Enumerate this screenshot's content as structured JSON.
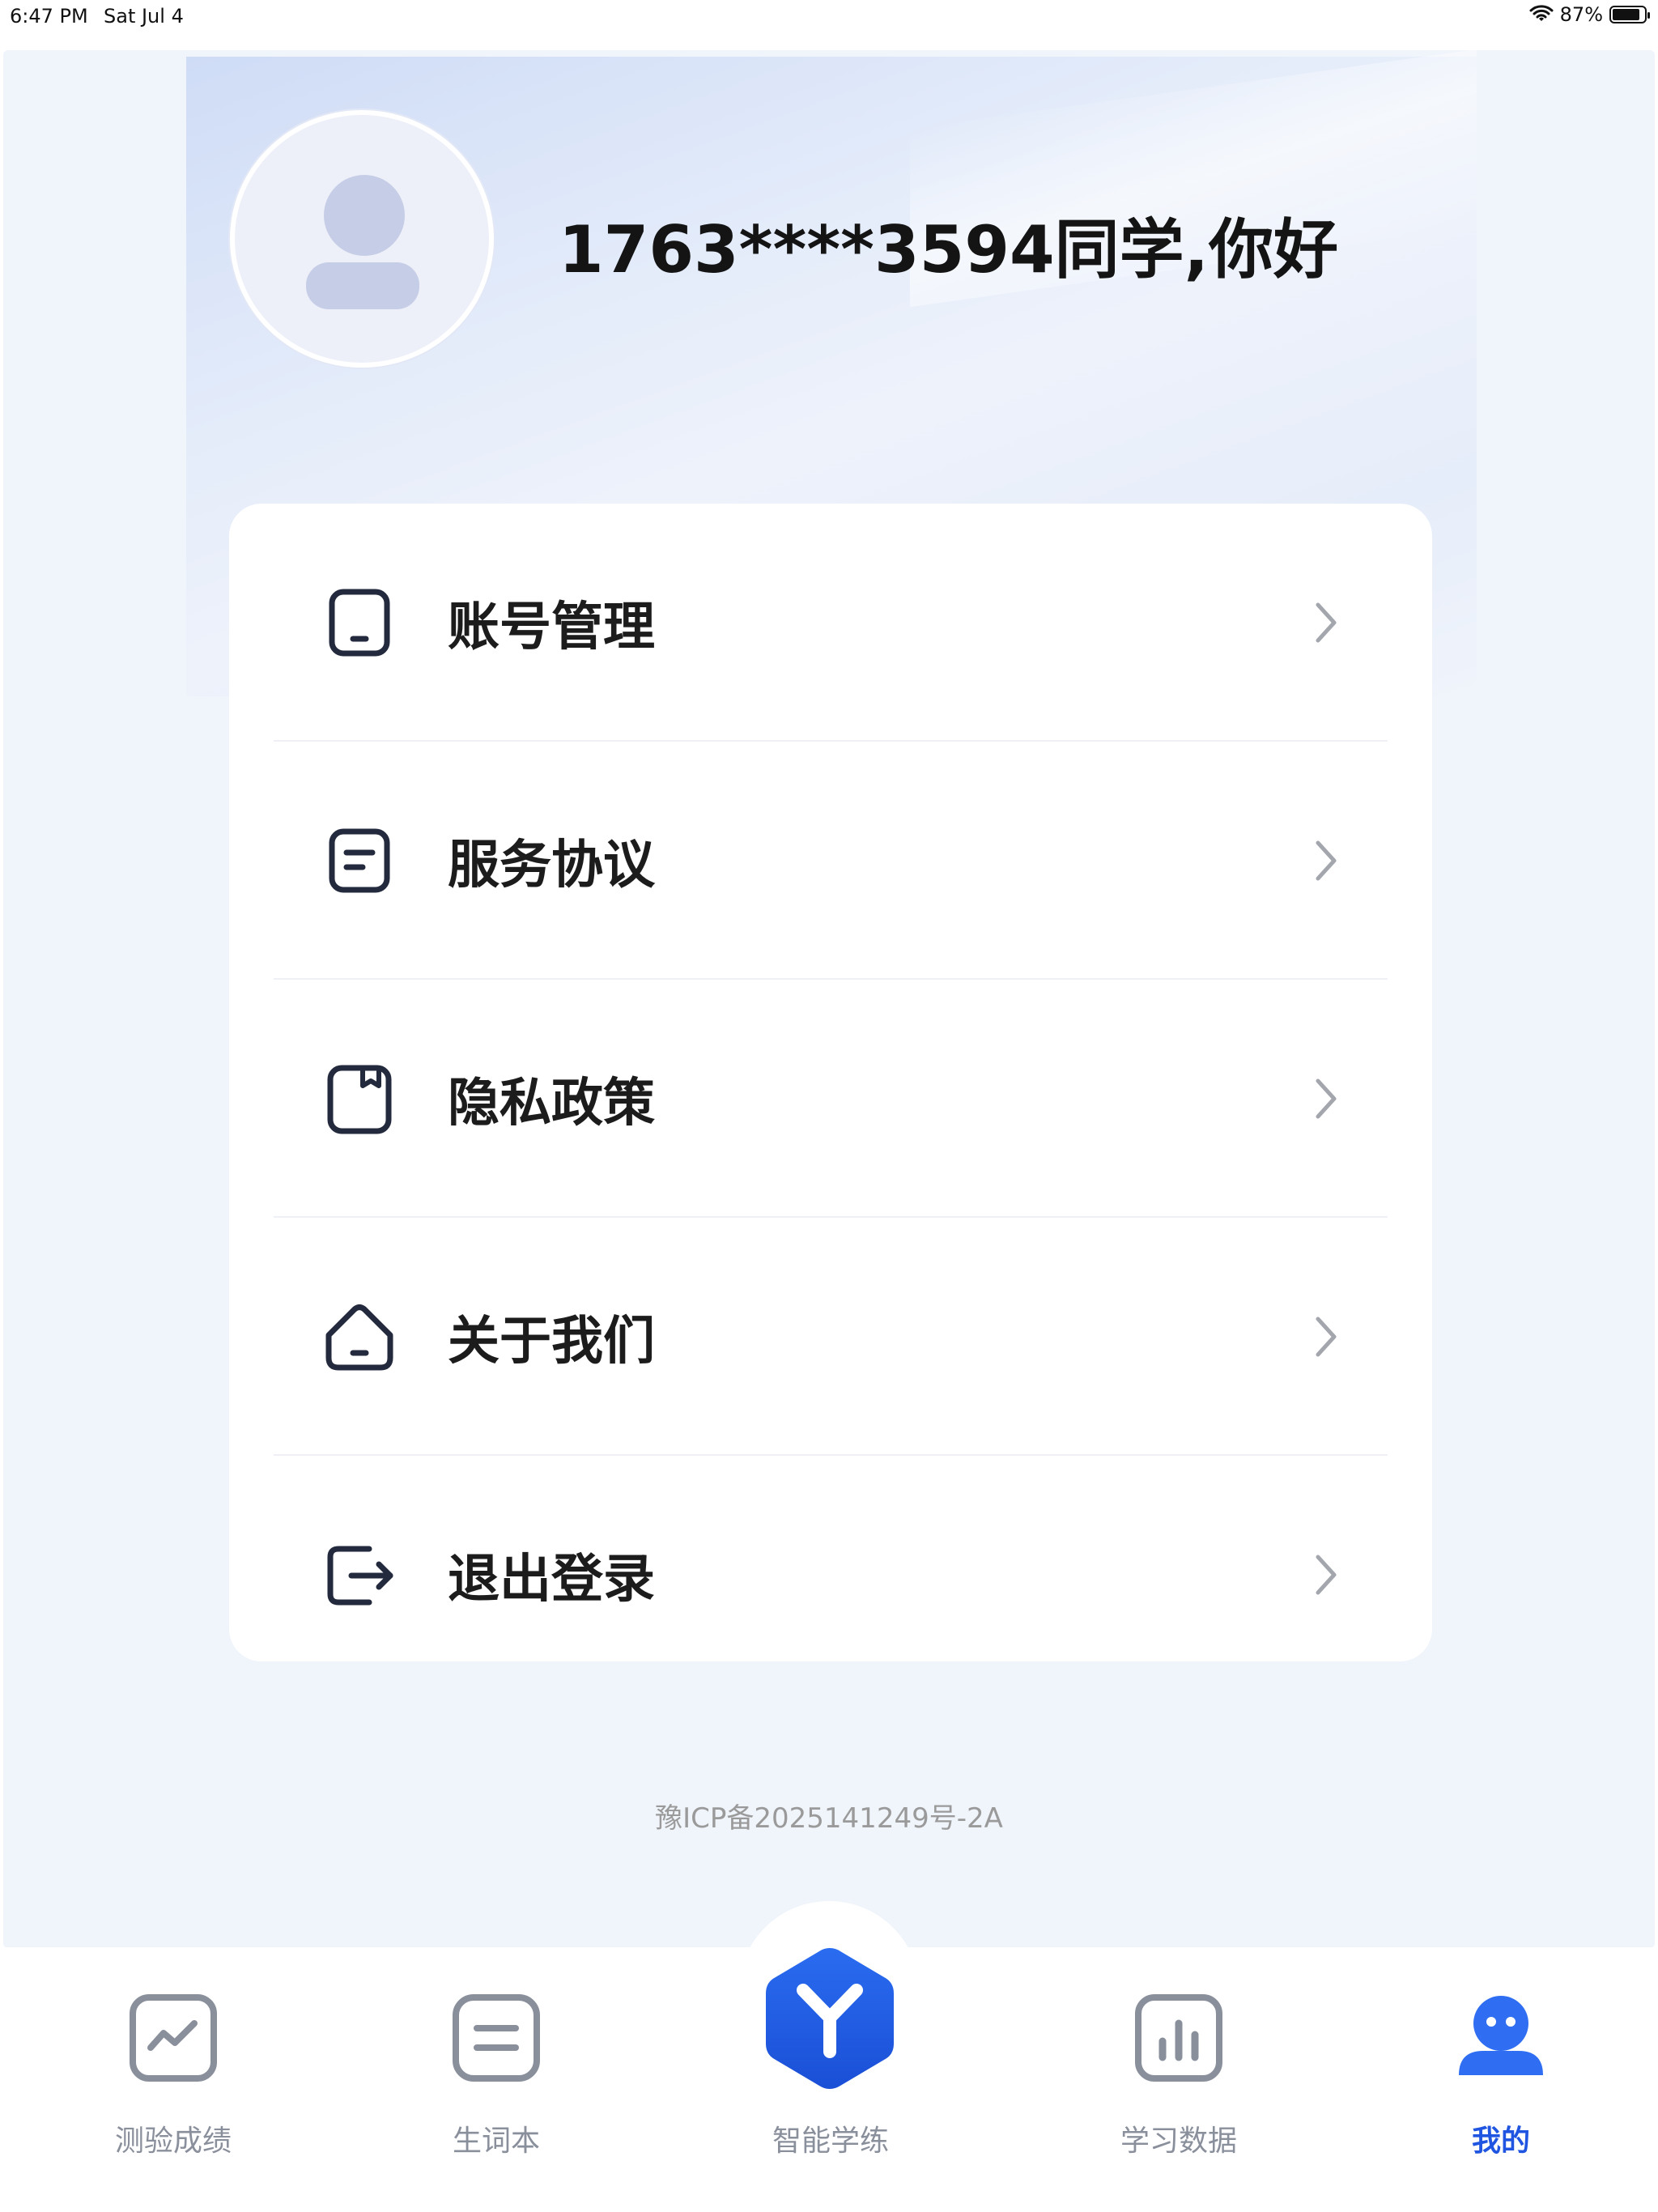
{
  "status_bar": {
    "time": "6:47 PM",
    "date": "Sat Jul 4",
    "battery": "87%",
    "battery_level": 0.87
  },
  "profile": {
    "greeting": "1763****3594同学,你好",
    "avatar_icon": "user-avatar-icon"
  },
  "menu": {
    "items": [
      {
        "label": "账号管理",
        "icon": "phone-icon"
      },
      {
        "label": "服务协议",
        "icon": "document-icon"
      },
      {
        "label": "隐私政策",
        "icon": "bookmark-icon"
      },
      {
        "label": "关于我们",
        "icon": "home-icon"
      },
      {
        "label": "退出登录",
        "icon": "logout-icon"
      }
    ]
  },
  "footer": {
    "icp": "豫ICP备2025141249号-2A"
  },
  "tabbar": {
    "tabs": [
      {
        "label": "测验成绩",
        "icon": "trend-chart-icon",
        "active": false
      },
      {
        "label": "生词本",
        "icon": "notebook-icon",
        "active": false
      },
      {
        "label": "智能学练",
        "icon": "smart-practice-icon",
        "active": false
      },
      {
        "label": "学习数据",
        "icon": "bar-chart-icon",
        "active": false
      },
      {
        "label": "我的",
        "icon": "profile-icon",
        "active": true
      }
    ]
  },
  "colors": {
    "accent": "#1f55e0",
    "page_bg": "#f0f4fb",
    "inactive_tab": "#8a8f9c"
  }
}
